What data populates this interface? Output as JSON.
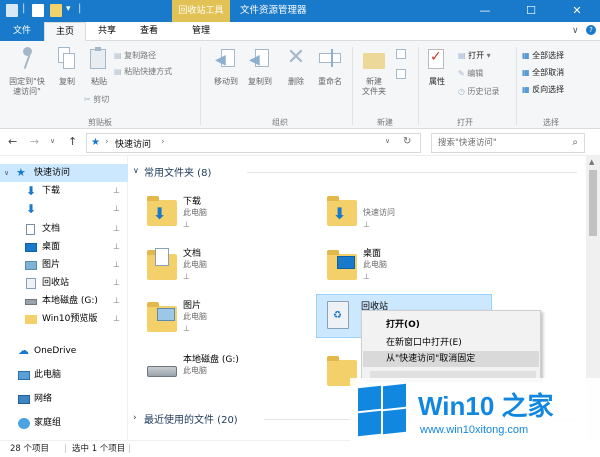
{
  "window": {
    "title": "文件资源管理器",
    "context_tab": "回收站工具",
    "minimize": "—",
    "maximize": "☐",
    "close": "✕",
    "colors": {
      "titlebar": "#1979ca",
      "context": "#e2c155",
      "accent": "#1979ca"
    }
  },
  "tabs": [
    {
      "label": "文件"
    },
    {
      "label": "主页"
    },
    {
      "label": "共享"
    },
    {
      "label": "查看"
    },
    {
      "label": "管理"
    }
  ],
  "ribbon": {
    "clipboard": {
      "pin": "固定到\"快",
      "pin2": "速访问\"",
      "copy": "复制",
      "paste": "粘贴",
      "copy_path": "复制路径",
      "paste_shortcut": "粘贴快捷方式",
      "cut": "剪切",
      "label": "剪贴板"
    },
    "organize": {
      "move_to": "移动到",
      "copy_to": "复制到",
      "delete": "删除",
      "rename": "重命名",
      "label": "组织"
    },
    "new": {
      "new_folder": "新建",
      "new_folder2": "文件夹",
      "label": "新建"
    },
    "open": {
      "properties": "属性",
      "open": "打开",
      "edit": "编辑",
      "history": "历史记录",
      "label": "打开"
    },
    "select": {
      "select_all": "全部选择",
      "select_none": "全部取消",
      "invert": "反向选择",
      "label": "选择"
    }
  },
  "nav": {
    "back": "←",
    "forward": "→",
    "recent": "∨",
    "up": "↑",
    "breadcrumb": "快速访问",
    "sep": "›",
    "dropdown": "∨",
    "refresh": "↻",
    "search_placeholder": "搜索\"快速访问\""
  },
  "sidebar": [
    {
      "label": "快速访问",
      "icon": "star-icon",
      "pinned": false
    },
    {
      "label": "下载",
      "icon": "download-icon",
      "pinned": true
    },
    {
      "label": "",
      "icon": "download-icon",
      "pinned": true
    },
    {
      "label": "文档",
      "icon": "document-icon",
      "pinned": true
    },
    {
      "label": "桌面",
      "icon": "desktop-icon",
      "pinned": true
    },
    {
      "label": "图片",
      "icon": "picture-icon",
      "pinned": true
    },
    {
      "label": "回收站",
      "icon": "recycle-bin-icon",
      "pinned": true
    },
    {
      "label": "本地磁盘 (G:)",
      "icon": "drive-icon",
      "pinned": true
    },
    {
      "label": "Win10预览版",
      "icon": "folder-icon",
      "pinned": true
    },
    {
      "label": "OneDrive",
      "icon": "onedrive-icon",
      "pinned": false
    },
    {
      "label": "此电脑",
      "icon": "computer-icon",
      "pinned": false
    },
    {
      "label": "网络",
      "icon": "network-icon",
      "pinned": false
    },
    {
      "label": "家庭组",
      "icon": "homegroup-icon",
      "pinned": false
    }
  ],
  "pin_glyph": "📌",
  "frequent": {
    "title": "常用文件夹 (8)",
    "chevron": "∨",
    "items": [
      {
        "name": "下载",
        "sub": "此电脑"
      },
      {
        "name": "",
        "sub": "快速访问"
      },
      {
        "name": "文档",
        "sub": "此电脑"
      },
      {
        "name": "桌面",
        "sub": "此电脑"
      },
      {
        "name": "图片",
        "sub": "此电脑"
      },
      {
        "name": "回收站",
        "sub": ""
      },
      {
        "name": "本地磁盘 (G:)",
        "sub": "此电脑"
      }
    ]
  },
  "recent": {
    "title": "最近使用的文件 (20)",
    "chevron": "›"
  },
  "context_menu": [
    {
      "label": "打开(O)",
      "bold": true
    },
    {
      "label": "在新窗口中打开(E)",
      "bold": false
    },
    {
      "label": "从\"快速访问\"取消固定",
      "bold": false
    }
  ],
  "status": {
    "count": "28 个项目",
    "selected": "选中 1 个项目"
  },
  "watermark": {
    "title": "Win10 之家",
    "url": "www.win10xitong.com"
  }
}
